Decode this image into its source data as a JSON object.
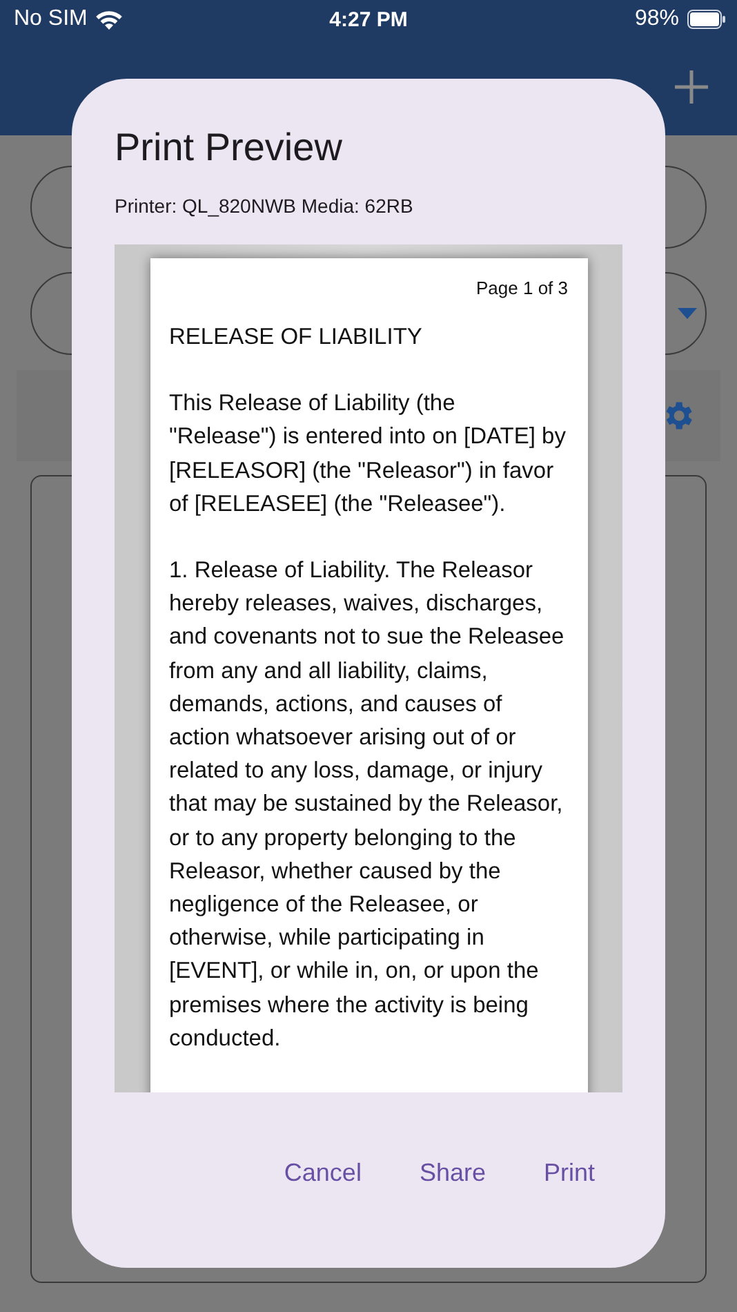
{
  "status_bar": {
    "carrier": "No SIM",
    "time": "4:27 PM",
    "battery": "98%"
  },
  "dialog": {
    "title": "Print Preview",
    "printer_info": "Printer: QL_820NWB  Media: 62RB",
    "preview": {
      "page_label": "Page 1 of 3",
      "paragraphs": [
        "RELEASE OF LIABILITY",
        "This Release of Liability (the \"Release\") is entered into on [DATE] by [RELEASOR] (the \"Releasor\") in favor of [RELEASEE] (the \"Releasee\").",
        "1. Release of Liability. The Releasor hereby releases, waives, discharges, and covenants not to sue the Releasee from any and all liability, claims, demands, actions, and causes of action whatsoever arising out of or related to any loss, damage, or injury that may be sustained by the Releasor, or to any property belonging to the Releasor, whether caused by the negligence of the Releasee, or otherwise, while participating in [EVENT], or while in, on, or upon the premises where the activity is being conducted."
      ]
    },
    "buttons": [
      "Cancel",
      "Share",
      "Print"
    ]
  }
}
